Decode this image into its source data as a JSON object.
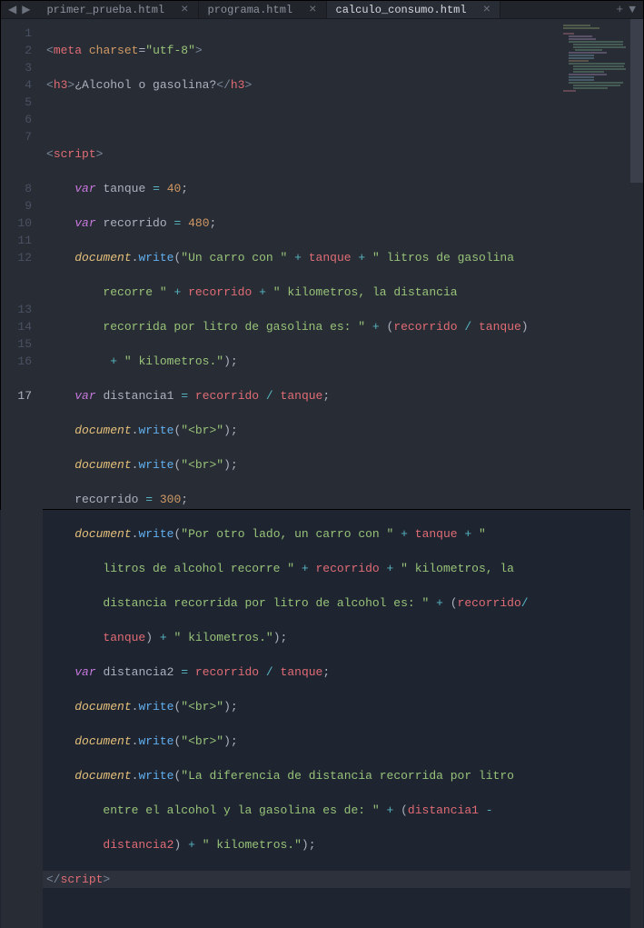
{
  "tabs": {
    "items": [
      {
        "name": "primer_prueba.html",
        "active": false
      },
      {
        "name": "programa.html",
        "active": false
      },
      {
        "name": "calculo_consumo.html",
        "active": true
      }
    ]
  },
  "gutter": {
    "lines": [
      "1",
      "2",
      "3",
      "4",
      "5",
      "6",
      "7",
      "",
      "",
      "8",
      "9",
      "10",
      "11",
      "12",
      "",
      "",
      "13",
      "14",
      "15",
      "16",
      "",
      "17"
    ],
    "activeIndex": 21
  },
  "code": {
    "l1_tag": "meta",
    "l1_attr": "charset",
    "l1_val": "\"utf-8\"",
    "l2_open": "h3",
    "l2_text": "¿Alcohol o gasolina?",
    "l2_close": "h3",
    "l4_tag": "script",
    "l5_kw": "var",
    "l5_name": "tanque",
    "l5_val": "40",
    "l6_kw": "var",
    "l6_name": "recorrido",
    "l6_val": "480",
    "l7_obj": "document",
    "l7_fn": "write",
    "l7_s1": "\"Un carro con \"",
    "l7_v1": "tanque",
    "l7_s2": "\" litros de gasolina ",
    "l7b_s": "recorre \"",
    "l7b_v": "recorrido",
    "l7b_s2": "\" kilometros, la distancia ",
    "l7c_s": "recorrida por litro de gasolina es: \"",
    "l7c_v1": "recorrido",
    "l7c_v2": "tanque",
    "l7d_s": "\" kilometros.\"",
    "l8_kw": "var",
    "l8_name": "distancia1",
    "l8_v1": "recorrido",
    "l8_v2": "tanque",
    "l9_obj": "document",
    "l9_fn": "write",
    "l9_s": "\"<br>\"",
    "l10_obj": "document",
    "l10_fn": "write",
    "l10_s": "\"<br>\"",
    "l11_name": "recorrido",
    "l11_val": "300",
    "l12_obj": "document",
    "l12_fn": "write",
    "l12_s1": "\"Por otro lado, un carro con \"",
    "l12_v1": "tanque",
    "l12_s2": "\" ",
    "l12b_s": "litros de alcohol recorre \"",
    "l12b_v": "recorrido",
    "l12b_s2": "\" kilometros, la ",
    "l12c_s": "distancia recorrida por litro de alcohol es: \"",
    "l12c_v1": "recorrido",
    "l12d_v": "tanque",
    "l12d_s": "\" kilometros.\"",
    "l13_kw": "var",
    "l13_name": "distancia2",
    "l13_v1": "recorrido",
    "l13_v2": "tanque",
    "l14_obj": "document",
    "l14_fn": "write",
    "l14_s": "\"<br>\"",
    "l15_obj": "document",
    "l15_fn": "write",
    "l15_s": "\"<br>\"",
    "l16_obj": "document",
    "l16_fn": "write",
    "l16_s1": "\"La diferencia de distancia recorrida por litro ",
    "l16b_s": "entre el alcohol y la gasolina es de: \"",
    "l16b_v1": "distancia1",
    "l16c_v": "distancia2",
    "l16c_s": "\" kilometros.\"",
    "l17_tag": "script"
  }
}
